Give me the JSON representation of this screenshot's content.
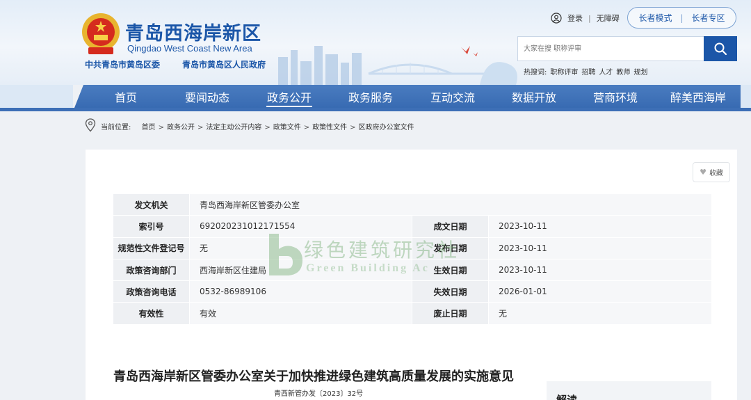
{
  "header": {
    "site_title": "青岛西海岸新区",
    "site_subtitle": "Qingdao West Coast New Area",
    "org_party": "中共青岛市黄岛区委",
    "org_gov": "青岛市黄岛区人民政府",
    "login": "登录",
    "accessibility": "无障碍",
    "elder_mode": "长者模式",
    "elder_zone": "长者专区",
    "search": {
      "placeholder": "大家在搜 职称评审"
    },
    "hot_search": {
      "label": "热搜词:",
      "items": [
        "职称评审",
        "招聘",
        "人才",
        "教师",
        "规划"
      ]
    },
    "colors": {
      "brand_blue": "#1b56a8",
      "nav_blue": "#3d6fb6"
    }
  },
  "nav": {
    "items": [
      {
        "label": "首页"
      },
      {
        "label": "要闻动态"
      },
      {
        "label": "政务公开",
        "active": true
      },
      {
        "label": "政务服务"
      },
      {
        "label": "互动交流"
      },
      {
        "label": "数据开放"
      },
      {
        "label": "营商环境"
      },
      {
        "label": "醉美西海岸"
      }
    ]
  },
  "breadcrumb": {
    "label": "当前位置:",
    "items": [
      "首页",
      "政务公开",
      "法定主动公开内容",
      "政策文件",
      "政策性文件",
      "区政府办公室文件"
    ]
  },
  "favorite": {
    "label": "收藏"
  },
  "info": {
    "issuer_label": "发文机关",
    "issuer": "青岛西海岸新区管委办公室",
    "index_label": "索引号",
    "index": "6920202310121715​54",
    "formed_label": "成文日期",
    "formed": "2023-10-11",
    "reg_label": "规范性文件登记号",
    "reg": "无",
    "publish_label": "发布日期",
    "publish": "2023-10-11",
    "dept_label": "政策咨询部门",
    "dept": "西海岸新区住建局",
    "effective_label": "生效日期",
    "effective": "2023-10-11",
    "phone_label": "政策咨询电话",
    "phone": "0532-86989106",
    "expire_label": "失效日期",
    "expire": "2026-01-01",
    "validity_label": "有效性",
    "validity": "有效",
    "abolish_label": "废止日期",
    "abolish": "无"
  },
  "watermark": {
    "text": "绿色建筑研究社",
    "sub": "Green Building Ac"
  },
  "document": {
    "title": "青岛西海岸新区管委办公室关于加快推进绿色建筑高质量发展的实施意见",
    "number": "青西新管办发〔2023〕32号"
  },
  "side": {
    "title": "解读"
  }
}
